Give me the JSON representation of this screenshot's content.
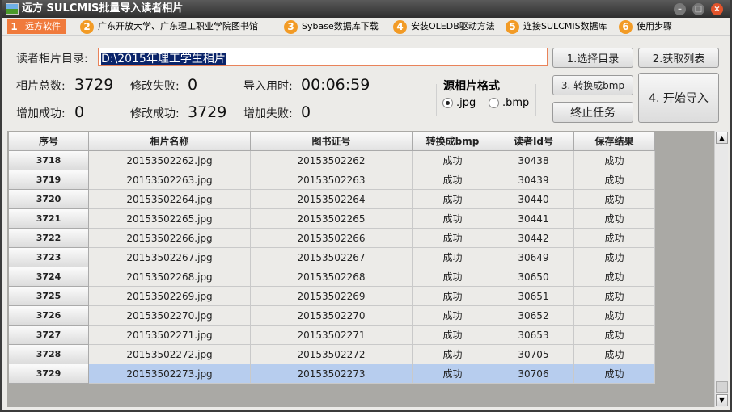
{
  "window": {
    "title": "远方 SULCMIS批量导入读者相片",
    "minimize": "–",
    "maximize": "□",
    "close": "×"
  },
  "menu": [
    {
      "num": "1",
      "label": "远方软件"
    },
    {
      "num": "2",
      "label": "广东开放大学、广东理工职业学院图书馆"
    },
    {
      "num": "3",
      "label": "Sybase数据库下载"
    },
    {
      "num": "4",
      "label": "安装OLEDB驱动方法"
    },
    {
      "num": "5",
      "label": "连接SULCMIS数据库"
    },
    {
      "num": "6",
      "label": "使用步骤"
    }
  ],
  "form": {
    "dir_label": "读者相片目录:",
    "dir_value": "D:\\2015年理工学生相片"
  },
  "stats": {
    "total_label": "相片总数:",
    "total": "3729",
    "modfail_label": "修改失败:",
    "modfail": "0",
    "time_label": "导入用时:",
    "time": "00:06:59",
    "addok_label": "增加成功:",
    "addok": "0",
    "modok_label": "修改成功:",
    "modok": "3729",
    "addfail_label": "增加失败:",
    "addfail": "0"
  },
  "format": {
    "title": "源相片格式",
    "jpg": ".jpg",
    "bmp": ".bmp",
    "selected": "jpg"
  },
  "buttons": {
    "select_dir": "1.选择目录",
    "get_list": "2.获取列表",
    "convert": "3. 转换成bmp",
    "start": "4. 开始导入",
    "stop": "终止任务"
  },
  "table": {
    "headers": [
      "序号",
      "相片名称",
      "图书证号",
      "转换成bmp",
      "读者Id号",
      "保存结果"
    ],
    "rows": [
      [
        "3718",
        "20153502262.jpg",
        "20153502262",
        "成功",
        "30438",
        "成功"
      ],
      [
        "3719",
        "20153502263.jpg",
        "20153502263",
        "成功",
        "30439",
        "成功"
      ],
      [
        "3720",
        "20153502264.jpg",
        "20153502264",
        "成功",
        "30440",
        "成功"
      ],
      [
        "3721",
        "20153502265.jpg",
        "20153502265",
        "成功",
        "30441",
        "成功"
      ],
      [
        "3722",
        "20153502266.jpg",
        "20153502266",
        "成功",
        "30442",
        "成功"
      ],
      [
        "3723",
        "20153502267.jpg",
        "20153502267",
        "成功",
        "30649",
        "成功"
      ],
      [
        "3724",
        "20153502268.jpg",
        "20153502268",
        "成功",
        "30650",
        "成功"
      ],
      [
        "3725",
        "20153502269.jpg",
        "20153502269",
        "成功",
        "30651",
        "成功"
      ],
      [
        "3726",
        "20153502270.jpg",
        "20153502270",
        "成功",
        "30652",
        "成功"
      ],
      [
        "3727",
        "20153502271.jpg",
        "20153502271",
        "成功",
        "30653",
        "成功"
      ],
      [
        "3728",
        "20153502272.jpg",
        "20153502272",
        "成功",
        "30705",
        "成功"
      ],
      [
        "3729",
        "20153502273.jpg",
        "20153502273",
        "成功",
        "30706",
        "成功"
      ]
    ],
    "selected_row": 11
  }
}
